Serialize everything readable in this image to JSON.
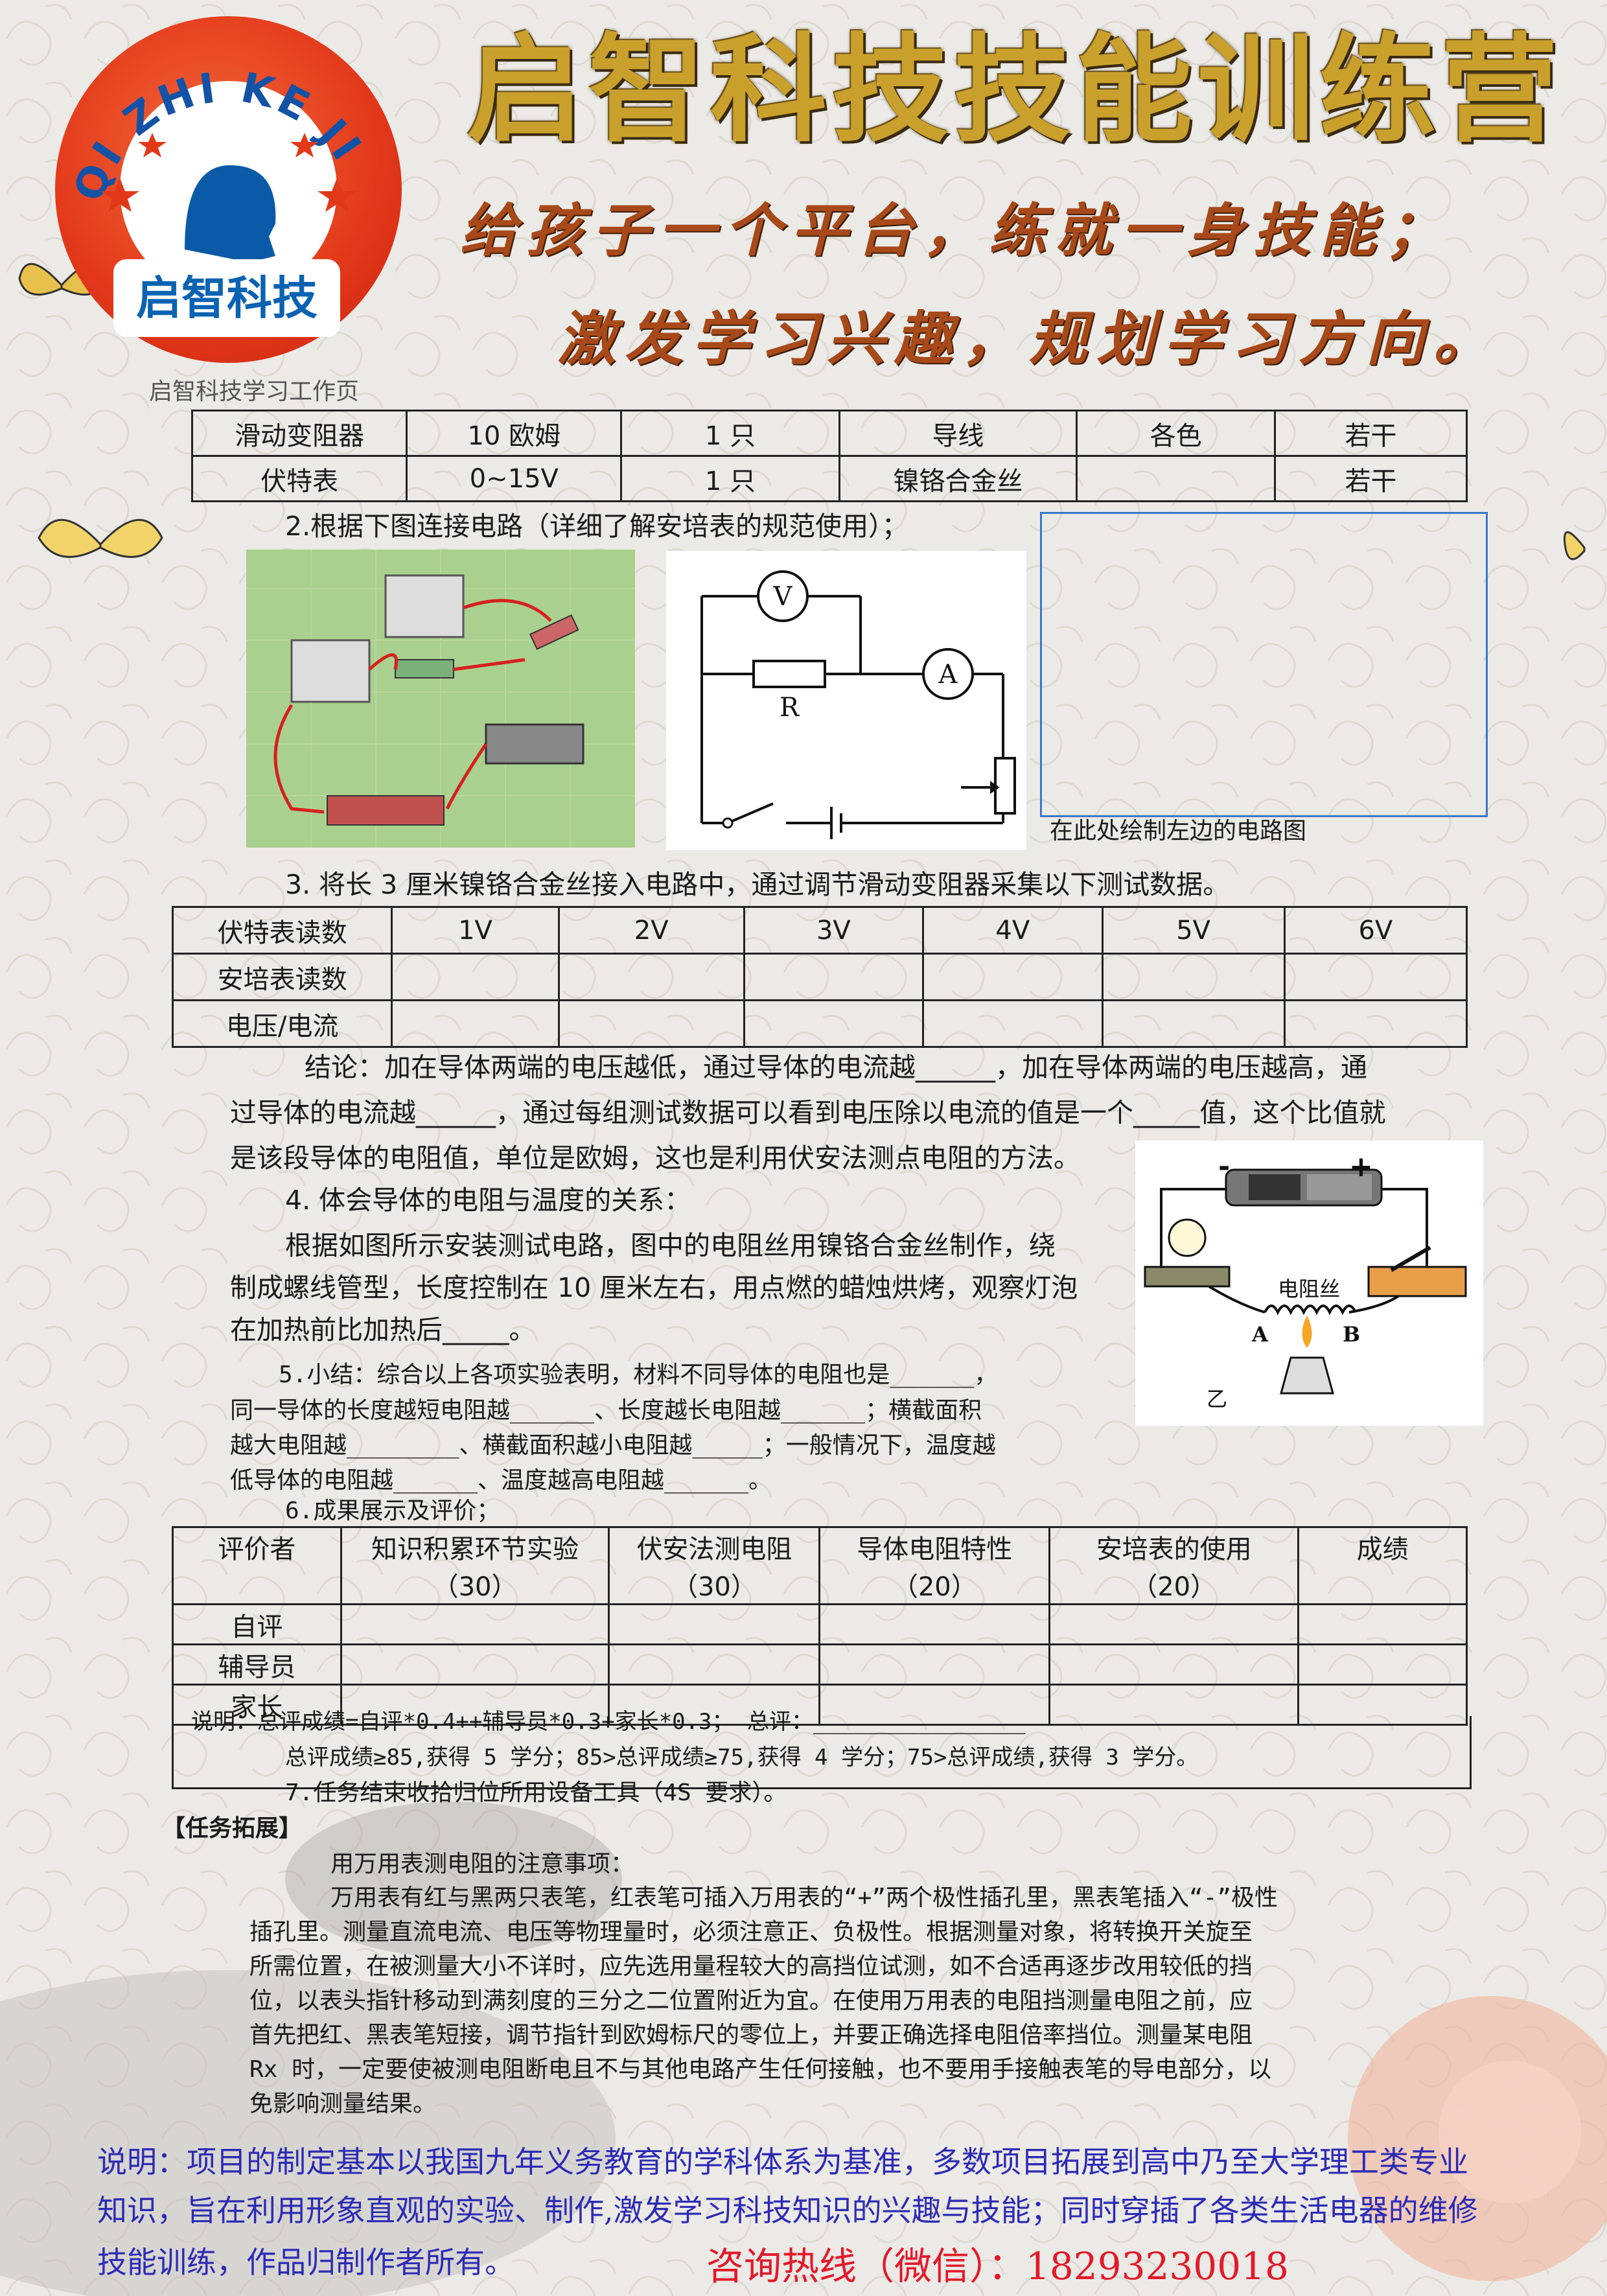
{
  "header": {
    "logo_arc_text": "QI ZHI KE JI",
    "logo_name": "启智科技",
    "title": "启智科技技能训练营",
    "slogan_line1": "给孩子一个平台，练就一身技能；",
    "slogan_line2": "激发学习兴趣，规划学习方向。",
    "note": "启智科技学习工作页"
  },
  "equipment_table": {
    "rows": [
      [
        "滑动变阻器",
        "10 欧姆",
        "1 只",
        "导线",
        "各色",
        "若干"
      ],
      [
        "伏特表",
        "0~15V",
        "1 只",
        "镍铬合金丝",
        "",
        "若干"
      ]
    ]
  },
  "step2": {
    "text": "2.根据下图连接电路（详细了解安培表的规范使用）；",
    "draw_caption": "在此处绘制左边的电路图",
    "circuit_labels": {
      "v": "V",
      "a": "A",
      "r": "R"
    }
  },
  "step3": {
    "text": "3.  将长 3 厘米镍铬合金丝接入电路中，通过调节滑动变阻器采集以下测试数据。",
    "table": {
      "rows": [
        [
          "伏特表读数",
          "1V",
          "2V",
          "3V",
          "4V",
          "5V",
          "6V"
        ],
        [
          "安培表读数",
          "",
          "",
          "",
          "",
          "",
          ""
        ],
        [
          "电压/电流",
          "",
          "",
          "",
          "",
          "",
          ""
        ]
      ]
    },
    "conclusion_l1": "结论：加在导体两端的电压越低，通过导体的电流越______，加在导体两端的电压越高，通",
    "conclusion_l2": "过导体的电流越______，通过每组测试数据可以看到电压除以电流的值是一个_____值，这个比值就",
    "conclusion_l3": "是该段导体的电阻值，单位是欧姆，这也是利用伏安法测点电阻的方法。"
  },
  "step4": {
    "title": "4.  体会导体的电阻与温度的关系：",
    "l1": "根据如图所示安装测试电路，图中的电阻丝用镍铬合金丝制作，绕",
    "l2": "制成螺线管型，长度控制在 10 厘米左右，用点燃的蜡烛烘烤，观察灯泡",
    "l3": "在加热前比加热后_____。",
    "fig_minus": "-",
    "fig_plus": "+",
    "fig_wire": "电阻丝",
    "fig_a": "A",
    "fig_b": "B",
    "fig_label": "乙"
  },
  "step5": {
    "l1": "5.小结：综合以上各项实验表明，材料不同导体的电阻也是______，",
    "l2": "同一导体的长度越短电阻越______、长度越长电阻越______；横截面积",
    "l3": "越大电阻越________、横截面积越小电阻越_____；一般情况下，温度越",
    "l4": "低导体的电阻越______、温度越高电阻越______。"
  },
  "step6": {
    "title": "6.成果展示及评价；",
    "headers": [
      "评价者",
      "知识积累环节实验",
      "伏安法测电阻",
      "导体电阻特性",
      "安培表的使用",
      "成绩"
    ],
    "scores": [
      "",
      "（30）",
      "（30）",
      "（20）",
      "（20）",
      ""
    ],
    "rows": [
      "自评",
      "辅导员",
      "家长"
    ],
    "note1": "说明：总评成绩=自评*0.4++辅导员*0.3+家长*0.3；    总评：________________",
    "note2": "总评成绩≥85,获得 5 学分；85>总评成绩≥75,获得 4 学分；75>总评成绩,获得 3 学分。"
  },
  "step7": {
    "text": "7.任务结束收拾归位所用设备工具（4S 要求）。"
  },
  "extension": {
    "title": "【任务拓展】",
    "subtitle": "用万用表测电阻的注意事项：",
    "lines": [
      "万用表有红与黑两只表笔，红表笔可插入万用表的“+”两个极性插孔里，黑表笔插入“-”极性",
      "插孔里。测量直流电流、电压等物理量时，必须注意正、负极性。根据测量对象，将转换开关旋至",
      "所需位置，在被测量大小不详时，应先选用量程较大的高挡位试测，如不合适再逐步改用较低的挡",
      "位，以表头指针移动到满刻度的三分之二位置附近为宜。在使用万用表的电阻挡测量电阻之前，应",
      "首先把红、黑表笔短接，调节指针到欧姆标尺的零位上，并要正确选择电阻倍率挡位。测量某电阻",
      "Rx 时，一定要使被测电阻断电且不与其他电路产生任何接触，也不要用手接触表笔的导电部分，以",
      "免影响测量结果。"
    ]
  },
  "footer": {
    "line1": "说明：项目的制定基本以我国九年义务教育的学科体系为基准，多数项目拓展到高中乃至大学理工类专业",
    "line2": "知识，旨在利用形象直观的实验、制作,激发学习科技知识的兴趣与技能；同时穿插了各类生活电器的维修",
    "line3": "技能训练，作品归制作者所有。",
    "hotline": "咨询热线（微信）：18293230018"
  },
  "colors": {
    "title_gold": "#c9a02c",
    "slogan": "#a8491a",
    "footer_blue": "#2d2ab5",
    "hotline_red": "#e2192a",
    "logo_red": "#e2381a"
  }
}
